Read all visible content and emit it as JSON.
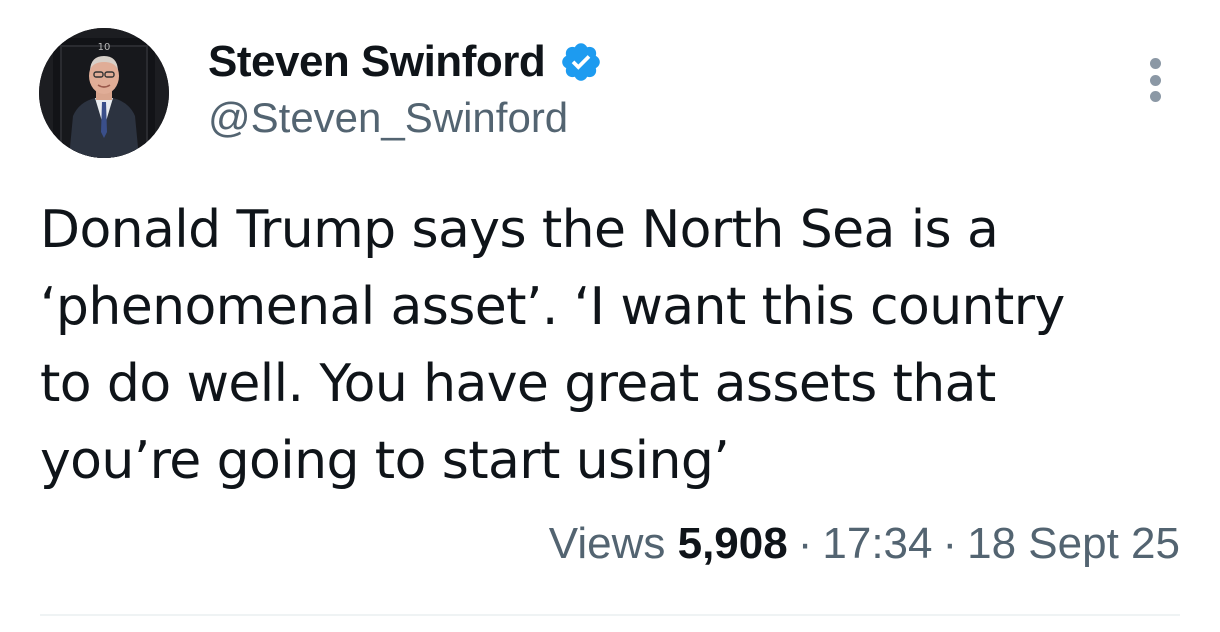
{
  "author": {
    "display_name": "Steven Swinford",
    "handle": "@Steven_Swinford",
    "verified": true,
    "avatar_icon": "profile-photo",
    "avatar_door_number": "10",
    "verified_color": "#1d9bf0"
  },
  "tweet": {
    "text": "Donald Trump says the North Sea is a\n‘phenomenal asset’. ‘I want this country\nto do well. You have great assets that\nyou’re going to start using’"
  },
  "meta": {
    "views_label": "Views",
    "views_count": "5,908",
    "separator": "·",
    "time": "17:34",
    "date": "18 Sept 25"
  },
  "icons": {
    "more": "more-options-icon",
    "verified": "verified-badge-icon"
  }
}
